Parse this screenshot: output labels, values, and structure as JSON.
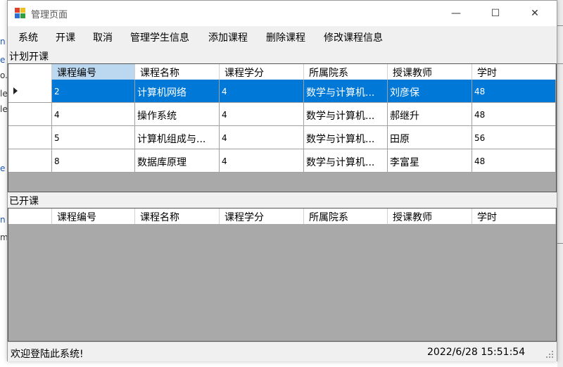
{
  "window": {
    "title": "管理页面"
  },
  "controls": {
    "minimize": "—",
    "maximize": "☐",
    "close": "✕"
  },
  "menu": [
    "系统",
    "开课",
    "取消",
    "管理学生信息",
    "添加课程",
    "删除课程",
    "修改课程信息"
  ],
  "planned": {
    "label": "计划开课",
    "columns": [
      "课程编号",
      "课程名称",
      "课程学分",
      "所属院系",
      "授课教师",
      "学时"
    ],
    "rows": [
      [
        "2",
        "计算机网络",
        "4",
        "数学与计算机...",
        "刘彦保",
        "48"
      ],
      [
        "4",
        "操作系统",
        "4",
        "数学与计算机...",
        "郝继升",
        "48"
      ],
      [
        "5",
        "计算机组成与...",
        "4",
        "数学与计算机...",
        "田原",
        "56"
      ],
      [
        "8",
        "数据库原理",
        "4",
        "数学与计算机...",
        "李富星",
        "48"
      ]
    ],
    "selected_row": 0
  },
  "opened": {
    "label": "已开课",
    "columns": [
      "课程编号",
      "课程名称",
      "课程学分",
      "所属院系",
      "授课教师",
      "学时"
    ],
    "rows": []
  },
  "status": {
    "message": "欢迎登陆此系统!",
    "datetime": "2022/6/28 15:51:54"
  },
  "colors": {
    "selection": "#0078d7",
    "grid_background": "#a9a9a9",
    "header_highlight": "#bcd8f0"
  }
}
